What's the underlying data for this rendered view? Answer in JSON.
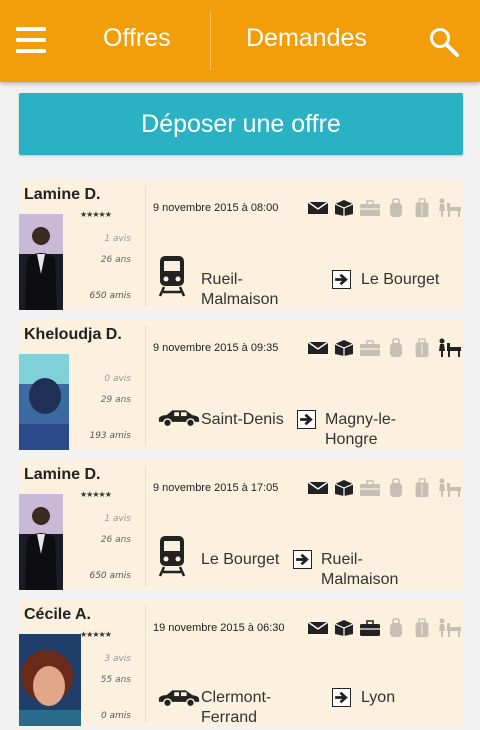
{
  "header": {
    "tabs": [
      "Offres",
      "Demandes"
    ]
  },
  "deposit_button": "Déposer une offre",
  "offers": [
    {
      "name": "Lamine D.",
      "stars": "★★★★★",
      "reviews": "1 avis",
      "age": "26 ans",
      "friends": "650 amis",
      "date": "9 novembre 2015 à 08:00",
      "vehicle": "train-icon",
      "from": [
        "Rueil-",
        "Malmaison"
      ],
      "to": [
        "Le Bourget"
      ]
    },
    {
      "name": "Kheloudja D.",
      "stars": "★★★★★",
      "reviews": "0 avis",
      "age": "29 ans",
      "friends": "193 amis",
      "date": "9 novembre 2015 à 09:35",
      "vehicle": "car-icon",
      "from": [
        "Saint-Denis"
      ],
      "to": [
        "Magny-le-",
        "Hongre"
      ]
    },
    {
      "name": "Lamine D.",
      "stars": "★★★★★",
      "reviews": "1 avis",
      "age": "26 ans",
      "friends": "650 amis",
      "date": "9 novembre 2015 à 17:05",
      "vehicle": "train-icon",
      "from": [
        "Le Bourget"
      ],
      "to": [
        "Rueil-",
        "Malmaison"
      ]
    },
    {
      "name": "Cécile A.",
      "stars": "★★★★★",
      "reviews": "3 avis",
      "age": "55 ans",
      "friends": "0 amis",
      "date": "19 novembre 2015 à 06:30",
      "vehicle": "car-icon",
      "from": [
        "Clermont-",
        "Ferrand"
      ],
      "to": [
        "Lyon"
      ]
    }
  ],
  "colors": {
    "header": "#f29d0a",
    "button": "#2ab2c4",
    "card": "#fbf1de"
  }
}
